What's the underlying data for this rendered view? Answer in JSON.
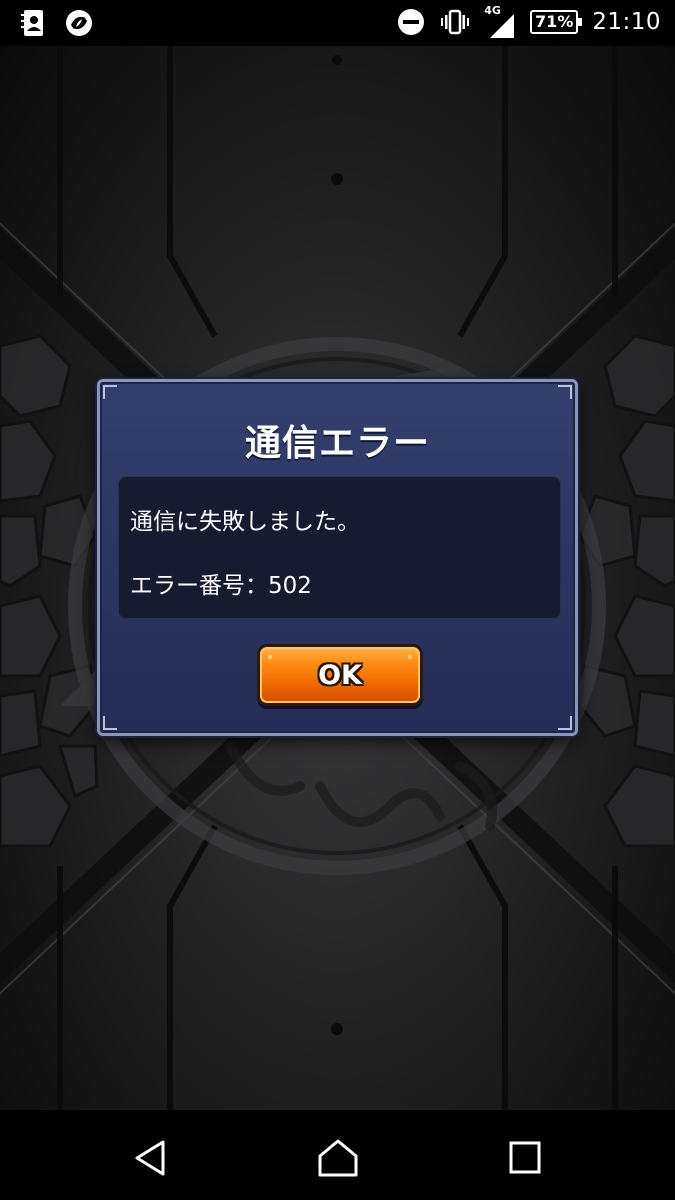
{
  "status_bar": {
    "time": "21:10",
    "battery": "71%",
    "network": "4G",
    "icons": [
      "contact-card-icon",
      "swirl-app-icon",
      "do-not-disturb-icon",
      "vibrate-icon",
      "signal-icon",
      "battery-icon"
    ]
  },
  "dialog": {
    "title": "通信エラー",
    "message_line1": "通信に失敗しました。",
    "message_line2": "エラー番号：502",
    "ok_label": "OK"
  },
  "nav_bar": {
    "icons": [
      "back-icon",
      "home-icon",
      "recent-apps-icon"
    ]
  },
  "colors": {
    "dialog_bg": "#2b3561",
    "message_bg": "#161b30",
    "ok_button": "#f06a00"
  }
}
